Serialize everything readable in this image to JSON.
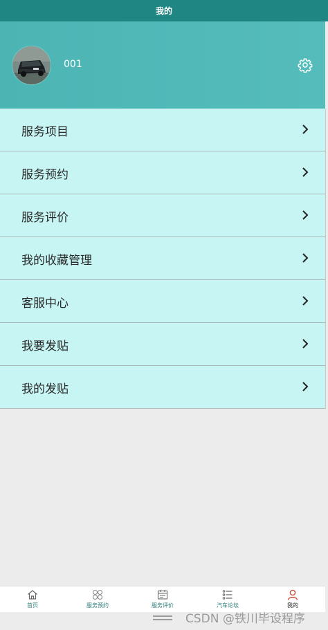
{
  "header": {
    "title": "我的"
  },
  "profile": {
    "username": "001",
    "avatar_icon": "car-photo-avatar",
    "settings_icon": "gear-icon"
  },
  "menu": [
    {
      "label": "服务项目"
    },
    {
      "label": "服务预约"
    },
    {
      "label": "服务评价"
    },
    {
      "label": "我的收藏管理"
    },
    {
      "label": "客服中心"
    },
    {
      "label": "我要发贴"
    },
    {
      "label": "我的发贴"
    }
  ],
  "tabbar": [
    {
      "label": "首页",
      "icon": "home-icon"
    },
    {
      "label": "服务预约",
      "icon": "grid-icon"
    },
    {
      "label": "服务评价",
      "icon": "calendar-icon"
    },
    {
      "label": "汽车论坛",
      "icon": "list-icon"
    },
    {
      "label": "我的",
      "icon": "user-icon",
      "active": true
    }
  ],
  "watermark": "CSDN @铁川毕设程序",
  "colors": {
    "header_bg": "#1f8684",
    "profile_bg": "#55bcbb",
    "menu_bg": "#c7f5f4",
    "tab_label": "#2c7c7a",
    "active_icon": "#c94a3a"
  }
}
